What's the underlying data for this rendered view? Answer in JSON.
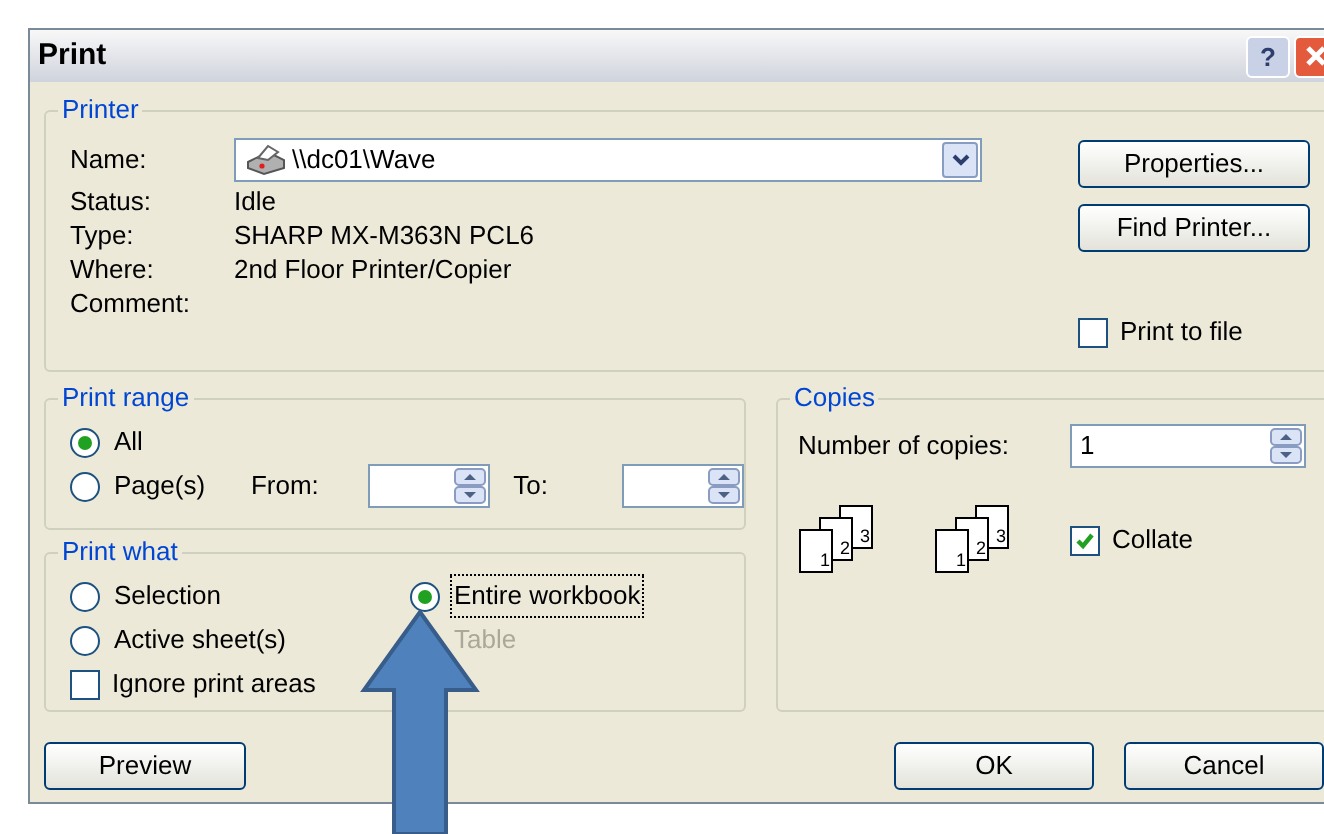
{
  "window": {
    "title": "Print",
    "help": "?"
  },
  "printer": {
    "legend": "Printer",
    "name_label": "Name:",
    "name_value": "\\\\dc01\\Wave",
    "fields": [
      {
        "label": "Status:",
        "value": "Idle"
      },
      {
        "label": "Type:",
        "value": "SHARP MX-M363N PCL6"
      },
      {
        "label": "Where:",
        "value": "2nd Floor Printer/Copier"
      },
      {
        "label": "Comment:"
      }
    ],
    "buttons": [
      "Properties...",
      "Find Printer..."
    ],
    "print_to_file": {
      "label": "Print to file",
      "checked": false
    }
  },
  "print_range": {
    "legend": "Print range",
    "options": [
      {
        "label": "All",
        "selected": true
      },
      {
        "label": "Page(s)",
        "selected": false
      }
    ],
    "from_label": "From:",
    "to_label": "To:"
  },
  "print_what": {
    "legend": "Print what",
    "options": [
      {
        "label": "Selection",
        "selected": false,
        "disabled": false,
        "focused": false
      },
      {
        "label": "Active sheet(s)",
        "selected": false,
        "disabled": false,
        "focused": false
      },
      {
        "label": "Entire workbook",
        "selected": true,
        "disabled": false,
        "focused": true
      },
      {
        "label": "Table",
        "disabled": true,
        "focused": false
      }
    ],
    "ignore_print_areas": {
      "label": "Ignore print areas",
      "checked": false
    }
  },
  "copies": {
    "legend": "Copies",
    "count_label": "Number of copies:",
    "count": "1",
    "collate_icons": [
      {
        "pages": [
          "1",
          "2",
          "3"
        ]
      },
      {
        "pages": [
          "1",
          "2",
          "3"
        ]
      }
    ],
    "collate": {
      "label": "Collate",
      "checked": true
    }
  },
  "footer": {
    "left": [
      "Preview"
    ],
    "right": [
      "OK",
      "Cancel"
    ]
  }
}
